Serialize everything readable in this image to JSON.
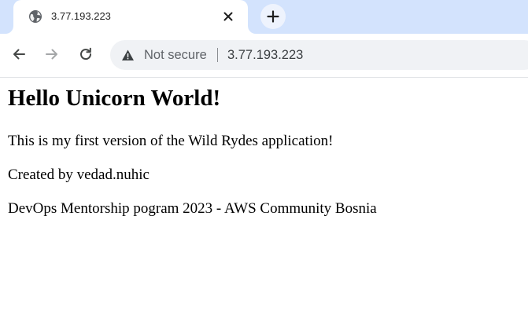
{
  "tab": {
    "title": "3.77.193.223",
    "favicon": "globe-icon",
    "close_icon": "close-icon"
  },
  "new_tab_icon": "plus-icon",
  "toolbar": {
    "back_icon": "back-arrow-icon",
    "forward_icon": "forward-arrow-icon",
    "reload_icon": "reload-icon"
  },
  "omnibox": {
    "security_icon": "warning-triangle-icon",
    "security_label": "Not secure",
    "url": "3.77.193.223"
  },
  "page": {
    "heading": "Hello Unicorn World!",
    "paragraphs": [
      "This is my first version of the Wild Rydes application!",
      "Created by vedad.nuhic",
      "DevOps Mentorship pogram 2023 - AWS Community Bosnia"
    ]
  },
  "colors": {
    "tabstrip_bg": "#d3e3fd",
    "omnibox_bg": "#f0f2f5",
    "new_tab_bg": "#eef3fd"
  }
}
